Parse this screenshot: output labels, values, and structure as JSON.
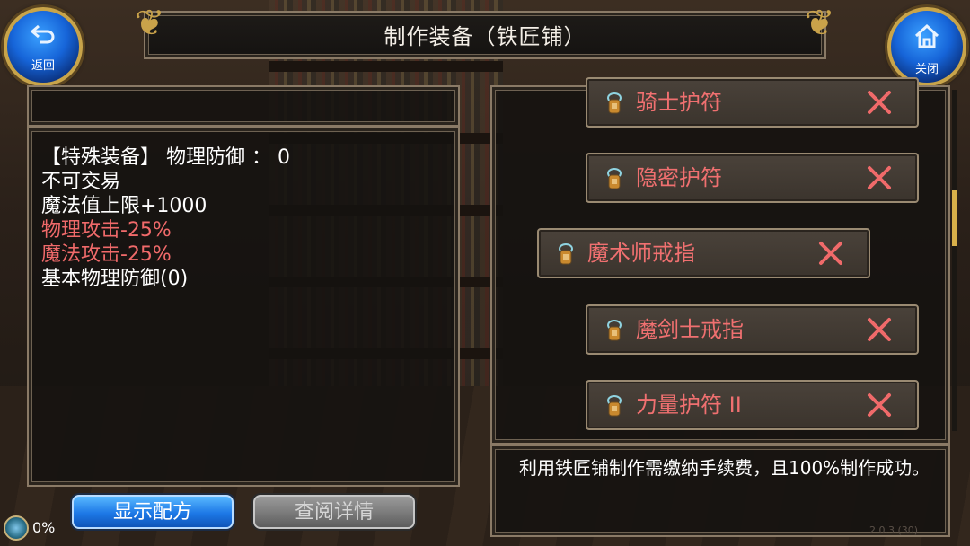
{
  "window": {
    "title": "制作装备（铁匠铺）"
  },
  "nav": {
    "back_label": "返回",
    "close_label": "关闭"
  },
  "item_detail": {
    "lines": [
      {
        "text": "【特殊装备】 物理防御 ：  0",
        "color": "#ffffff"
      },
      {
        "text": "不可交易",
        "color": "#ffffff"
      },
      {
        "text": "魔法值上限+1000",
        "color": "#ffffff"
      },
      {
        "text": "物理攻击-25%",
        "color": "#f06a6a"
      },
      {
        "text": "魔法攻击-25%",
        "color": "#f06a6a"
      },
      {
        "text": "基本物理防御(0)",
        "color": "#ffffff"
      }
    ]
  },
  "buttons": {
    "show_recipe": "显示配方",
    "view_detail": "查阅详情"
  },
  "recipes": [
    {
      "name": "骑士护符",
      "icon": "amulet-icon",
      "selected": false
    },
    {
      "name": "隐密护符",
      "icon": "amulet-icon",
      "selected": false
    },
    {
      "name": "魔术师戒指",
      "icon": "ring-icon",
      "selected": true
    },
    {
      "name": "魔剑士戒指",
      "icon": "ring-icon",
      "selected": false
    },
    {
      "name": "力量护符 II",
      "icon": "amulet-icon",
      "selected": false
    }
  ],
  "info": {
    "text": "利用铁匠铺制作需缴纳手续费，且100%制作成功。"
  },
  "status": {
    "progress_text": "0%",
    "version_text": "2.0.3.(30)"
  },
  "colors": {
    "accent_blue": "#1d78e6",
    "recipe_name": "#f07070",
    "frame_border": "#8a7a66",
    "gold": "#c8a44a"
  }
}
